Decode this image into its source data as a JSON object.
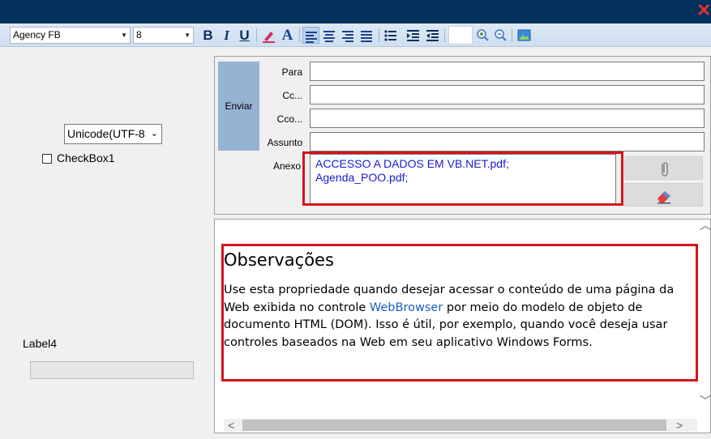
{
  "window": {
    "close_glyph": "✕"
  },
  "toolbar": {
    "font_name": "Agency FB",
    "font_size": "8",
    "bold": "B",
    "italic": "I",
    "underline": "U",
    "font_color": "A",
    "active_align": "align-left"
  },
  "left_panel": {
    "encoding_select": "Unicode(UTF-8",
    "checkbox_label": "CheckBox1",
    "checkbox_checked": false,
    "label4": "Label4",
    "progress": 0
  },
  "email": {
    "send_label": "Enviar",
    "to_label": "Para",
    "cc_label": "Cc...",
    "bcc_label": "Cco...",
    "subject_label": "Assunto",
    "attachment_label": "Anexo",
    "to_value": "",
    "cc_value": "",
    "bcc_value": "",
    "subject_value": "",
    "attachments": [
      "ACCESSO A DADOS EM VB.NET.pdf;",
      "Agenda_POO.pdf;"
    ]
  },
  "browser": {
    "title": "Observações",
    "text_before_link": "Use esta propriedade quando desejar acessar o conteúdo de uma página da Web exibida no controle ",
    "link_text": "WebBrowser",
    "text_after_link": " por meio do modelo de objeto de documento HTML (DOM). Isso é útil, por exemplo, quando você deseja usar controles baseados na Web em seu aplicativo Windows Forms."
  },
  "colors": {
    "titlebar": "#04305e",
    "highlight": "#d4141c",
    "link": "#1a5fbf",
    "attachment_text": "#1a1ad0"
  }
}
